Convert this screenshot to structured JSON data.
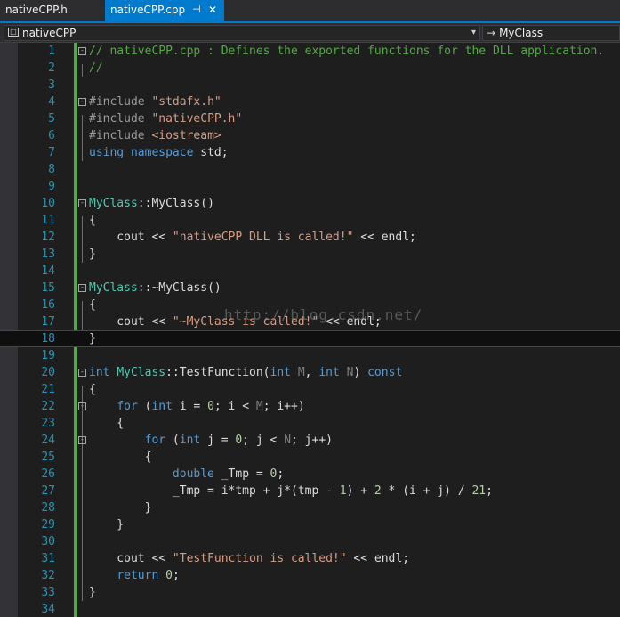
{
  "tabs": [
    {
      "label": "nativeCPP.h",
      "active": false
    },
    {
      "label": "nativeCPP.cpp",
      "active": true,
      "pin_icon": "pin-icon",
      "close_icon": "close-icon"
    }
  ],
  "nav": {
    "project": "nativeCPP",
    "scope": "MyClass",
    "project_icon": "class-view-icon",
    "scope_icon": "arrow-right-icon"
  },
  "colors": {
    "background": "#1e1e1e",
    "line_number": "#2b91af",
    "comment": "#57a64a",
    "string": "#d69d85",
    "keyword": "#569cd6",
    "type": "#4ec9b0",
    "accent": "#007acc"
  },
  "watermark": "http://blog.csdn.net/",
  "code_lines": [
    {
      "n": "1",
      "text": "// nativeCPP.cpp : Defines the exported functions for the DLL application."
    },
    {
      "n": "2",
      "text": "//"
    },
    {
      "n": "3",
      "text": ""
    },
    {
      "n": "4",
      "text": "#include \"stdafx.h\""
    },
    {
      "n": "5",
      "text": "#include \"nativeCPP.h\""
    },
    {
      "n": "6",
      "text": "#include <iostream>"
    },
    {
      "n": "7",
      "text": "using namespace std;"
    },
    {
      "n": "8",
      "text": ""
    },
    {
      "n": "9",
      "text": ""
    },
    {
      "n": "10",
      "text": "MyClass::MyClass()"
    },
    {
      "n": "11",
      "text": "{"
    },
    {
      "n": "12",
      "text": "    cout << \"nativeCPP DLL is called!\" << endl;"
    },
    {
      "n": "13",
      "text": "}"
    },
    {
      "n": "14",
      "text": ""
    },
    {
      "n": "15",
      "text": "MyClass::~MyClass()"
    },
    {
      "n": "16",
      "text": "{"
    },
    {
      "n": "17",
      "text": "    cout << \"~MyClass is called!\" << endl;"
    },
    {
      "n": "18",
      "text": "}"
    },
    {
      "n": "19",
      "text": ""
    },
    {
      "n": "20",
      "text": "int MyClass::TestFunction(int M, int N) const"
    },
    {
      "n": "21",
      "text": "{"
    },
    {
      "n": "22",
      "text": "    for (int i = 0; i < M; i++)"
    },
    {
      "n": "23",
      "text": "    {"
    },
    {
      "n": "24",
      "text": "        for (int j = 0; j < N; j++)"
    },
    {
      "n": "25",
      "text": "        {"
    },
    {
      "n": "26",
      "text": "            double _Tmp = 0;"
    },
    {
      "n": "27",
      "text": "            _Tmp = i*tmp + j*(tmp - 1) + 2 * (i + j) / 21;"
    },
    {
      "n": "28",
      "text": "        }"
    },
    {
      "n": "29",
      "text": "    }"
    },
    {
      "n": "30",
      "text": ""
    },
    {
      "n": "31",
      "text": "    cout << \"TestFunction is called!\" << endl;"
    },
    {
      "n": "32",
      "text": "    return 0;"
    },
    {
      "n": "33",
      "text": "}"
    },
    {
      "n": "34",
      "text": ""
    }
  ]
}
